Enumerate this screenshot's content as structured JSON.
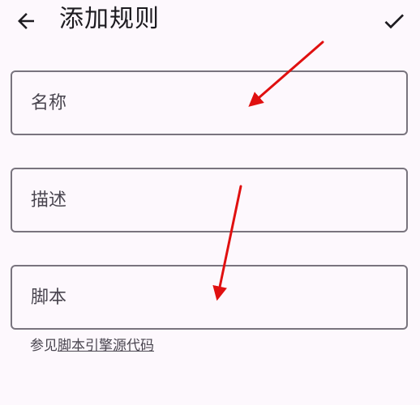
{
  "header": {
    "title": "添加规则",
    "back_icon": "arrow-back-icon",
    "confirm_icon": "check-icon"
  },
  "form": {
    "name_placeholder": "名称",
    "name_value": "",
    "description_placeholder": "描述",
    "description_value": "",
    "script_placeholder": "脚本",
    "script_value": ""
  },
  "helper": {
    "prefix": "参见",
    "link_text": "脚本引擎源代码"
  },
  "colors": {
    "background": "#fdf8fd",
    "outline": "#79747e",
    "annotation_arrow": "#e01010"
  }
}
